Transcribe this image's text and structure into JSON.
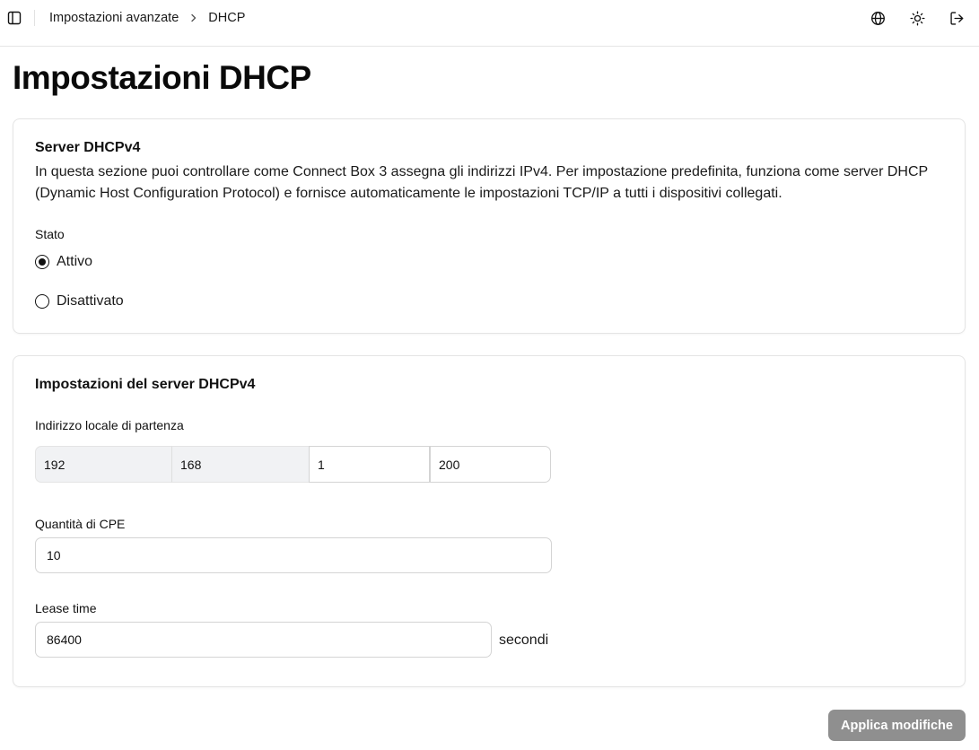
{
  "breadcrumb": {
    "parent": "Impostazioni avanzate",
    "current": "DHCP"
  },
  "header": {
    "icons": [
      "panel-left-icon",
      "globe-icon",
      "sun-icon",
      "logout-icon"
    ]
  },
  "page": {
    "title": "Impostazioni DHCP"
  },
  "server_card": {
    "title": "Server DHCPv4",
    "description": "In questa sezione puoi controllare come Connect Box 3 assegna gli indirizzi IPv4. Per impostazione predefinita, funziona come server DHCP (Dynamic Host Configuration Protocol) e fornisce automaticamente le impostazioni TCP/IP a tutti i dispositivi collegati.",
    "status_label": "Stato",
    "options": [
      {
        "label": "Attivo",
        "selected": true
      },
      {
        "label": "Disattivato",
        "selected": false
      }
    ]
  },
  "settings_card": {
    "title": "Impostazioni del server DHCPv4",
    "start_address": {
      "label": "Indirizzo locale di partenza",
      "octets": [
        "192",
        "168",
        "1",
        "200"
      ]
    },
    "cpe_quantity": {
      "label": "Quantità di CPE",
      "value": "10"
    },
    "lease_time": {
      "label": "Lease time",
      "value": "86400",
      "unit": "secondi"
    }
  },
  "actions": {
    "apply_label": "Applica modifiche"
  },
  "colors": {
    "button_disabled": "#8f8f8f",
    "readonly_bg": "#f1f2f4",
    "border": "#e4e4e4"
  }
}
